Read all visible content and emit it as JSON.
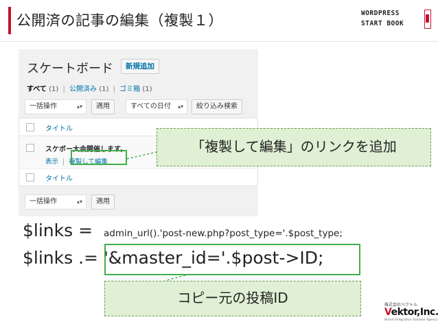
{
  "slide": {
    "title": "公開済の記事の編集（複製１）",
    "logo_top_line1": "WORDPRESS",
    "logo_top_line2": "START BOOK",
    "accent_color": "#c8102e"
  },
  "wp": {
    "heading": "スケートボード",
    "add_new": "新規追加",
    "filters": {
      "all": "すべて",
      "all_count": "(1)",
      "published": "公開済み",
      "published_count": "(1)",
      "trash": "ゴミ箱",
      "trash_count": "(1)",
      "sep": "|"
    },
    "bulk_action_select": "一括操作",
    "apply_button": "適用",
    "date_select": "すべての日付",
    "filter_button": "絞り込み検索",
    "table_header": "タイトル",
    "table_footer": "タイトル",
    "post": {
      "title": "スケボー大会開催します。",
      "action_view": "表示",
      "action_sep": "|",
      "action_duplicate": "複製して編集"
    }
  },
  "callouts": {
    "top": "「複製して編集」のリンクを追加",
    "bottom": "コピー元の投稿ID",
    "fill_color": "#dff0d4",
    "border_color": "#6d9a55"
  },
  "code": {
    "line1_var": "$links = ",
    "line1_expr": "admin_url().'post-new.php?post_type='.$post_type;",
    "line2_var": "$links .= ",
    "line2_expr": "'&master_id='.$post->ID;",
    "highlight_color": "#3fae49"
  },
  "vektor_logo": {
    "pre": "株式会社ベクトル",
    "name_v": "V",
    "name_rest": "ektor,Inc.",
    "tagline": "Brand Integration Solution Agency"
  }
}
